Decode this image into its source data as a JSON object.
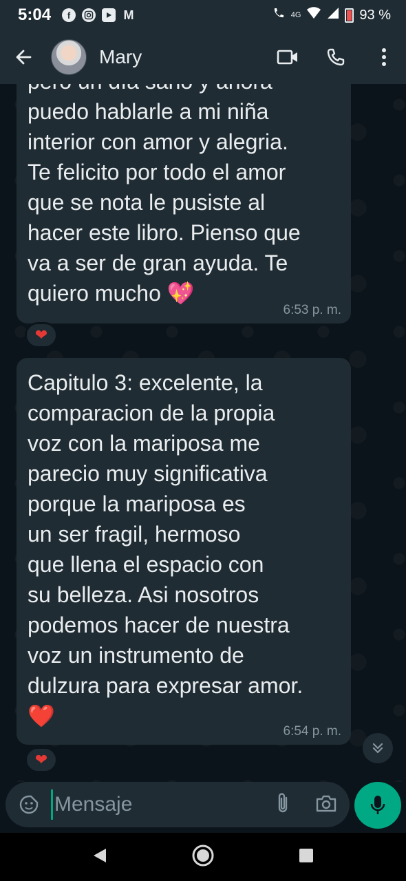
{
  "status_bar": {
    "time": "5:04",
    "network_label": "4G",
    "battery_percent": "93 %",
    "app_icons": [
      "facebook-icon",
      "instagram-icon",
      "youtube-icon",
      "gmail-icon"
    ]
  },
  "header": {
    "contact_name": "Mary",
    "icons": [
      "back-arrow-icon",
      "video-call-icon",
      "phone-icon",
      "more-options-icon"
    ]
  },
  "messages": [
    {
      "text": "pero un día sano y ahora\npuedo hablarle a mi niña\ninterior con amor y alegria.\nTe felicito por todo el amor\nque se nota le pusiste al\nhacer este libro. Pienso que\nva a ser de gran ayuda. Te\nquiero mucho 💖",
      "time": "6:53 p. m.",
      "reaction": "❤"
    },
    {
      "text": "Capitulo 3: excelente, la\ncomparacion de la propia\nvoz con la mariposa me\nparecio muy significativa\nporque la mariposa es\nun ser fragil, hermoso\nque llena el espacio con\nsu belleza. Asi nosotros\npodemos hacer de nuestra\nvoz un instrumento de\ndulzura para expresar amor.\n❤️",
      "time": "6:54 p. m.",
      "reaction": "❤"
    }
  ],
  "composer": {
    "placeholder": "Mensaje"
  },
  "colors": {
    "accent": "#00a884",
    "bubble": "#202c33",
    "background": "#0b141a",
    "bar": "#1f2c34"
  }
}
